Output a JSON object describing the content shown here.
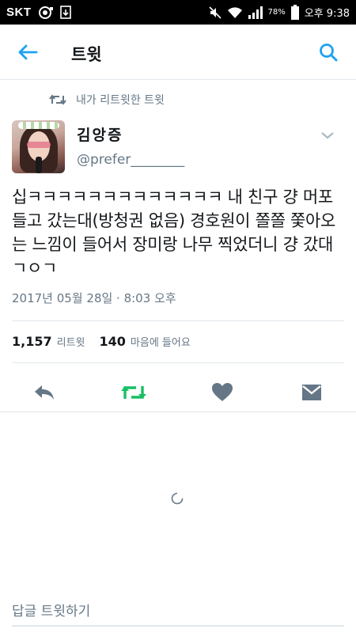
{
  "status_bar": {
    "carrier": "SKT",
    "battery": "78%",
    "time": "오후 9:38"
  },
  "header": {
    "title": "트윗",
    "back_icon": "arrow-left-icon",
    "search_icon": "search-icon",
    "accent_color": "#1da1f2"
  },
  "retweet_context": {
    "label": "내가 리트윗한 트윗",
    "icon": "retweet-icon"
  },
  "author": {
    "name": "김앙증",
    "handle": "@prefer________"
  },
  "tweet": {
    "text": "십ㅋㅋㅋㅋㅋㅋㅋㅋㅋㅋㅋㅋㅋ 내 친구 걍 머포 들고 갔는대(방청권 없음) 경호원이 쫄쫄 쫓아오는 느낌이 들어서 장미랑 나무 찍었더니 걍 갔대 ㄱㅇㄱ",
    "timestamp": "2017년 05월 28일 · 8:03 오후"
  },
  "stats": {
    "retweets_count": "1,157",
    "retweets_label": "리트윗",
    "likes_count": "140",
    "likes_label": "마음에 들어요"
  },
  "actions": {
    "retweeted_color": "#17bf63",
    "icon_color": "#657786",
    "items": [
      "reply-icon",
      "retweet-icon",
      "heart-icon",
      "direct-message-icon"
    ]
  },
  "reply": {
    "placeholder": "답글 트윗하기"
  }
}
